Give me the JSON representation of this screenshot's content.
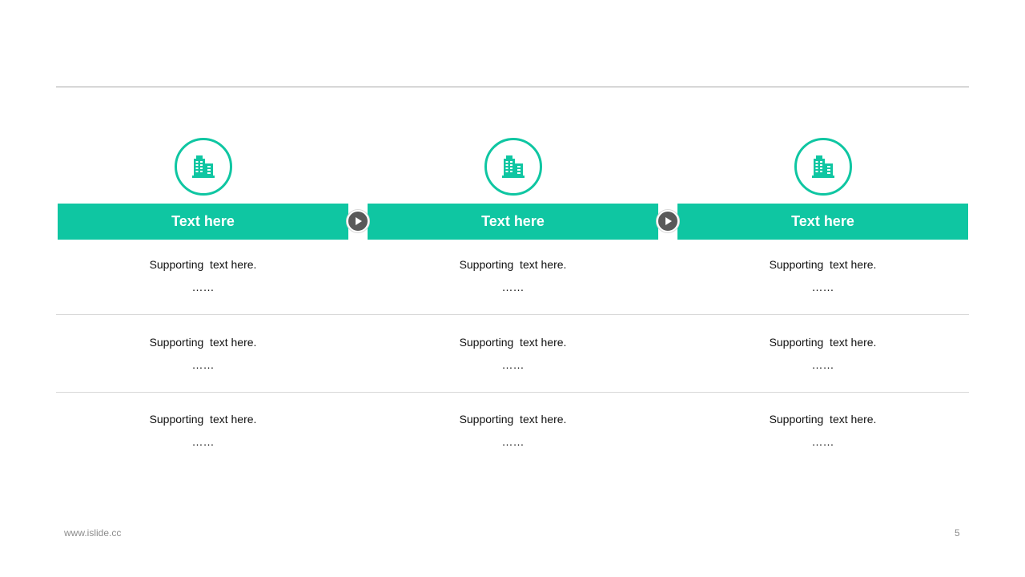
{
  "colors": {
    "accent": "#0fc6a2",
    "arrow": "#595959"
  },
  "columns": [
    {
      "icon": "building-icon",
      "title": "Text here"
    },
    {
      "icon": "building-icon",
      "title": "Text here"
    },
    {
      "icon": "building-icon",
      "title": "Text here"
    }
  ],
  "rows": [
    [
      {
        "text": "Supporting  text here.",
        "ellipsis": "……"
      },
      {
        "text": "Supporting  text here.",
        "ellipsis": "……"
      },
      {
        "text": "Supporting  text here.",
        "ellipsis": "……"
      }
    ],
    [
      {
        "text": "Supporting  text here.",
        "ellipsis": "……"
      },
      {
        "text": "Supporting  text here.",
        "ellipsis": "……"
      },
      {
        "text": "Supporting  text here.",
        "ellipsis": "……"
      }
    ],
    [
      {
        "text": "Supporting  text here.",
        "ellipsis": "……"
      },
      {
        "text": "Supporting  text here.",
        "ellipsis": "……"
      },
      {
        "text": "Supporting  text here.",
        "ellipsis": "……"
      }
    ]
  ],
  "arrows": [
    "play-arrow-icon",
    "play-arrow-icon"
  ],
  "footer": {
    "url": "www.islide.cc",
    "page": "5"
  }
}
